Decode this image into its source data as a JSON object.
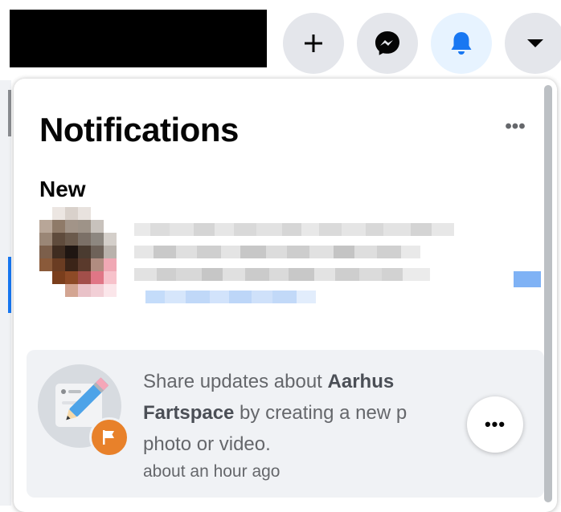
{
  "header": {
    "create_icon": "plus-icon",
    "messenger_icon": "messenger-icon",
    "notifications_icon": "bell-icon",
    "account_icon": "caret-down-icon",
    "accent_color": "#1877f2"
  },
  "panel": {
    "title": "Notifications",
    "more_label": "•••",
    "section_new": "New"
  },
  "notification": {
    "text_prefix": "Share updates about ",
    "page_name_line1": "Aarhus",
    "page_name_line2": "Fartspace",
    "text_mid": " by creating a new p",
    "text_line3": "photo or video.",
    "time": "about an hour ago",
    "more_label": "•••",
    "badge_icon": "flag-icon",
    "avatar_icon": "pencil-post-icon",
    "badge_color": "#e8812a"
  }
}
